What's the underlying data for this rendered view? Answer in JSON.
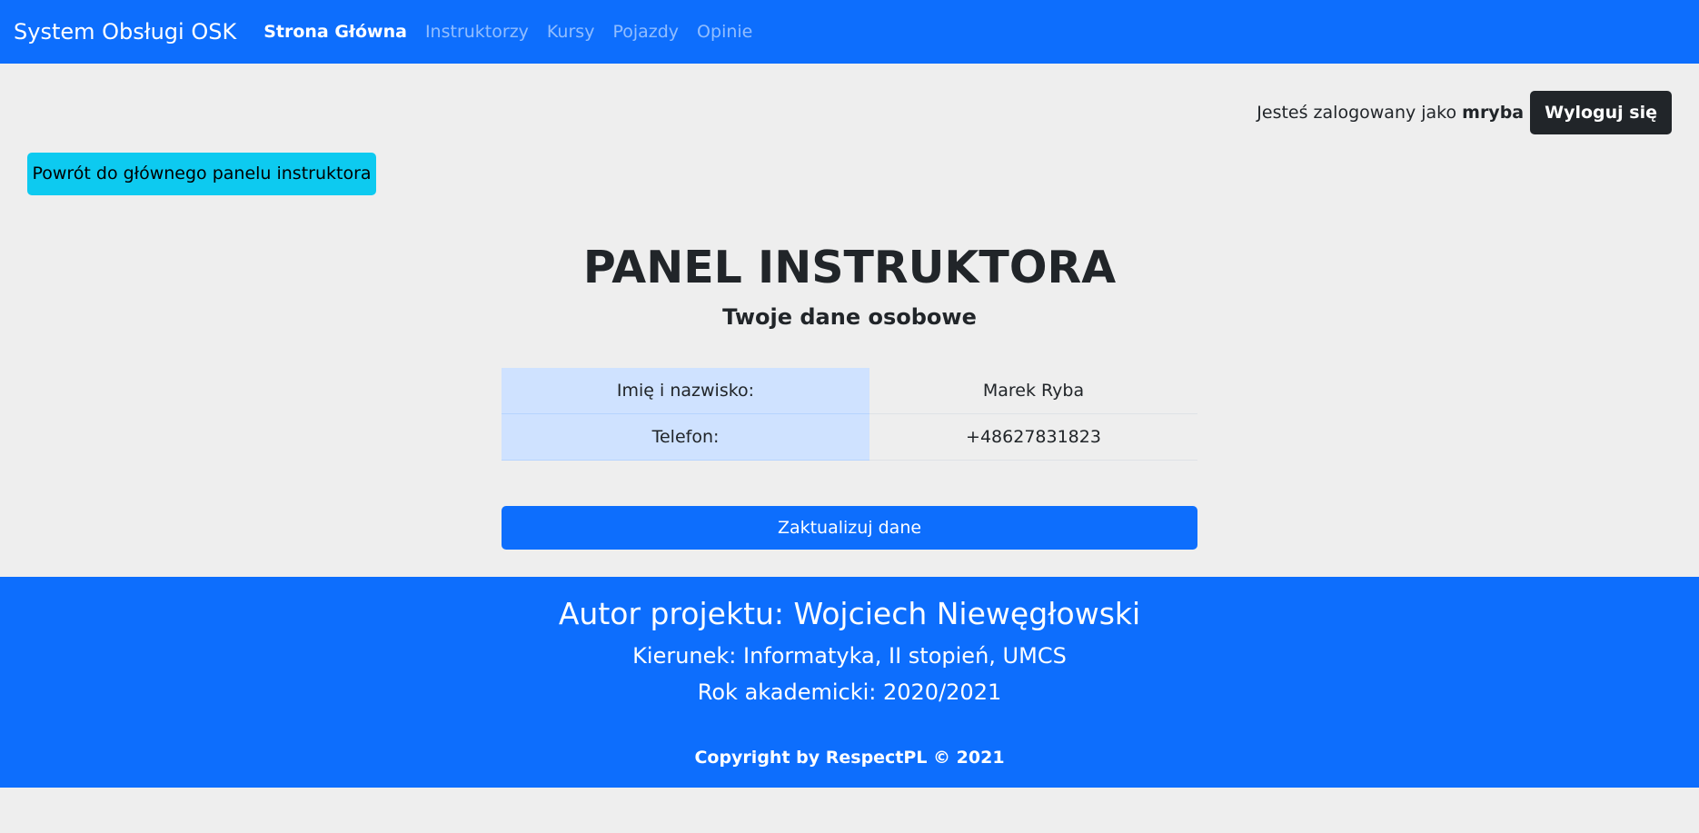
{
  "navbar": {
    "brand": "System Obsługi OSK",
    "links": [
      {
        "label": "Strona Główna"
      },
      {
        "label": "Instruktorzy"
      },
      {
        "label": "Kursy"
      },
      {
        "label": "Pojazdy"
      },
      {
        "label": "Opinie"
      }
    ],
    "active_index": 0
  },
  "session": {
    "logged_in_text": "Jesteś zalogowany jako",
    "username": "mryba",
    "logout_label": "Wyloguj się"
  },
  "back_button": {
    "label": "Powrót do głównego panelu instruktora"
  },
  "main": {
    "title": "PANEL INSTRUKTORA",
    "subtitle": "Twoje dane osobowe",
    "details": [
      {
        "label": "Imię i nazwisko:",
        "value": "Marek Ryba"
      },
      {
        "label": "Telefon:",
        "value": "+48627831823"
      }
    ],
    "update_label": "Zaktualizuj dane"
  },
  "footer": {
    "author": "Autor projektu: Wojciech Niewęgłowski",
    "course": "Kierunek: Informatyka, II stopień, UMCS",
    "year": "Rok akademicki: 2020/2021",
    "copyright": "Copyright by RespectPL © 2021"
  },
  "colors": {
    "primary": "#0d6efd",
    "info": "#0dcaf0",
    "dark": "#212529",
    "table_label_bg": "#cfe2ff",
    "page_bg": "#eeeeee"
  }
}
